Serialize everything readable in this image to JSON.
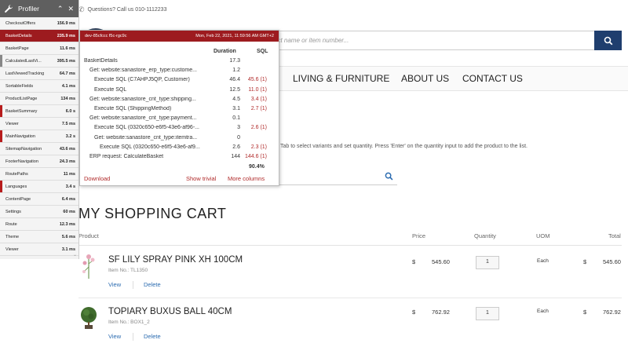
{
  "topbar": {
    "question": "Questions? Call us 010-1112233"
  },
  "search": {
    "placeholder": "uct name or item number..."
  },
  "nav": {
    "items": [
      "LIVING & FURNITURE",
      "ABOUT US",
      "CONTACT US"
    ]
  },
  "quick_order": {
    "hint": "ants. Tab to select variants and set quantity. Press 'Enter' on the quantity input to add the product to the list."
  },
  "cart": {
    "title": "MY SHOPPING CART",
    "headers": {
      "product": "Product",
      "price": "Price",
      "quantity": "Quantity",
      "uom": "UOM",
      "total": "Total"
    },
    "items": [
      {
        "name": "SF LILY SPRAY PINK XH 100CM",
        "item_no": "Item No.: TL1350",
        "currency": "$",
        "price": "545.60",
        "qty": "1",
        "uom": "Each",
        "total_currency": "$",
        "total": "545.60",
        "view": "View",
        "delete": "Delete"
      },
      {
        "name": "TOPIARY BUXUS BALL 40CM",
        "item_no": "Item No.: BOX1_2",
        "currency": "$",
        "price": "762.92",
        "qty": "1",
        "uom": "Each",
        "total_currency": "$",
        "total": "762.92",
        "view": "View",
        "delete": "Delete"
      }
    ]
  },
  "profiler": {
    "title": "Profiler",
    "rows": [
      {
        "name": "CheckoutOffers",
        "time": "156.9 ms",
        "mark": ""
      },
      {
        "name": "BasketDetails",
        "time": "235.9 ms",
        "mark": "active"
      },
      {
        "name": "BasketPage",
        "time": "11.6 ms",
        "mark": ""
      },
      {
        "name": "CalculatedLastVi...",
        "time": "395.5 ms",
        "mark": "#888888"
      },
      {
        "name": "LastViewedTracking",
        "time": "64.7 ms",
        "mark": ""
      },
      {
        "name": "SortableFields",
        "time": "4.1 ms",
        "mark": ""
      },
      {
        "name": "ProductListPage",
        "time": "134 ms",
        "mark": ""
      },
      {
        "name": "BasketSummary",
        "time": "6.0 s",
        "mark": "#b71c1c"
      },
      {
        "name": "Viewer",
        "time": "7.5 ms",
        "mark": ""
      },
      {
        "name": "MainNavigation",
        "time": "3.2 s",
        "mark": "#b71c1c"
      },
      {
        "name": "SitemapNavigation",
        "time": "43.6 ms",
        "mark": ""
      },
      {
        "name": "FooterNavigation",
        "time": "24.3 ms",
        "mark": ""
      },
      {
        "name": "RoutePaths",
        "time": "11 ms",
        "mark": ""
      },
      {
        "name": "Languages",
        "time": "3.4 s",
        "mark": "#b71c1c"
      },
      {
        "name": "ContentPage",
        "time": "6.4 ms",
        "mark": ""
      },
      {
        "name": "Settings",
        "time": "60 ms",
        "mark": ""
      },
      {
        "name": "Route",
        "time": "12.3 ms",
        "mark": ""
      },
      {
        "name": "Theme",
        "time": "5.6 ms",
        "mark": ""
      },
      {
        "name": "Viewer",
        "time": "3.1 ms",
        "mark": ""
      }
    ]
  },
  "detail": {
    "host": "dev-85cfccc f5c-rgc9c",
    "timestamp": "Mon, Feb 22, 2021, 11:59:56 AM GMT+2",
    "col_duration": "Duration",
    "col_sql": "SQL",
    "rows": [
      {
        "label": "BasketDetails",
        "duration": "17.3",
        "sql": ""
      },
      {
        "label": "Get: website:sanastore_erp_type:custome...",
        "duration": "1.2",
        "sql": ""
      },
      {
        "label": "Execute SQL (C7AHPJ5QP, Customer)",
        "duration": "46.4",
        "sql": "45.6 (1)"
      },
      {
        "label": "Execute SQL",
        "duration": "12.5",
        "sql": "11.0 (1)"
      },
      {
        "label": "Get: website:sanastore_cnt_type:shipping...",
        "duration": "4.5",
        "sql": "3.4 (1)"
      },
      {
        "label": "Execute SQL (ShippingMethod)",
        "duration": "3.1",
        "sql": "2.7 (1)"
      },
      {
        "label": "Get: website:sanastore_cnt_type:payment...",
        "duration": "0.1",
        "sql": ""
      },
      {
        "label": "Execute SQL (0320c650-e6f5-43e6-af96-...",
        "duration": "3",
        "sql": "2.6 (1)"
      },
      {
        "label": "Get: website:sanastore_cnt_type:itemtra...",
        "duration": "0",
        "sql": ""
      },
      {
        "label": "Execute SQL (0320c650-e6f5-43e6-af9...",
        "duration": "2.6",
        "sql": "2.3 (1)"
      },
      {
        "label": "ERP request: CalculateBasket",
        "duration": "144",
        "sql": "144.6 (1)"
      }
    ],
    "total_pct": "90.4%",
    "download": "Download",
    "show_trivial": "Show trivial",
    "more_columns": "More columns"
  }
}
